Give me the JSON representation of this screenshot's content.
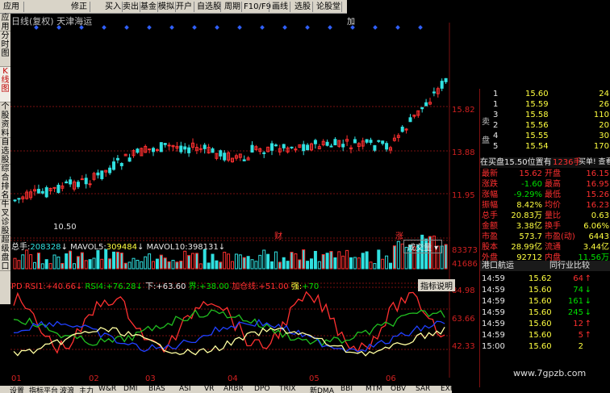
{
  "toolbar": {
    "items": [
      "应用",
      "修正",
      "买入",
      "卖出",
      "基金",
      "模拟",
      "开户",
      "自选股",
      "周期",
      "F10/F9",
      "画线",
      "选股",
      "论股堂"
    ],
    "right_label": "加"
  },
  "sidebar_tabs": [
    "应用",
    "分时图",
    "K线图",
    "个股资料",
    "自选股",
    "综合排名",
    "牛叉诊股",
    "超级盘口"
  ],
  "chart": {
    "title": "日线(复权)",
    "stock_name": "天津海运",
    "min_label": "10.50",
    "price_ticks": [
      "15.82",
      "13.88",
      "11.95"
    ],
    "vol_ticks": [
      "83373",
      "41686"
    ],
    "ind_ticks": [
      "84.98",
      "63.66",
      "42.33"
    ],
    "date_ticks": [
      "01",
      "02",
      "03",
      "04",
      "05",
      "06"
    ],
    "markers": [
      "财",
      "涨"
    ],
    "colors": {
      "up": "#ff3030",
      "down": "#30e0e0",
      "grid": "#7a1010"
    }
  },
  "volume_panel": {
    "label_total": "总手:",
    "total": "208328",
    "mavol5_label": "MAVOL5:",
    "mavol5": "309484",
    "mavol10_label": "MAVOL10:",
    "mavol10": "398131",
    "dropdown": "成交量"
  },
  "indicator_panel": {
    "parts": [
      "PD RSI1:",
      "+40.66",
      "RSI4:",
      "+76.28",
      "下:",
      "+63.60",
      "界:",
      "+38.00",
      "加仓线:",
      "+51.00",
      "强:",
      "+70"
    ],
    "help_button": "指标说明"
  },
  "order_book": {
    "sell_label": "卖",
    "buy_label": "盘",
    "sells": [
      [
        "1",
        "15.60",
        "24"
      ],
      [
        "1",
        "15.59",
        "26"
      ],
      [
        "3",
        "15.58",
        "110"
      ],
      [
        "2",
        "15.56",
        "20"
      ],
      [
        "4",
        "15.55",
        "30"
      ],
      [
        "5",
        "15.54",
        "170"
      ]
    ]
  },
  "status_line": {
    "text": "在买盘15.50位置有",
    "qty": "1236手",
    "link": "买单! 查看详细"
  },
  "stats": [
    [
      "最新",
      "15.62",
      "开盘",
      "16.15"
    ],
    [
      "涨跌",
      "-1.60",
      "最高",
      "16.95"
    ],
    [
      "涨幅",
      "-9.29%",
      "最低",
      "15.26"
    ],
    [
      "振幅",
      "8.42%",
      "均价",
      "16.23"
    ],
    [
      "总手",
      "20.83万",
      "量比",
      "0.63"
    ],
    [
      "金额",
      "3.38亿",
      "换手",
      "6.06%"
    ],
    [
      "市盈",
      "573.7",
      "市盈(动)",
      "6443"
    ],
    [
      "股本",
      "28.99亿",
      "流通",
      "3.44亿"
    ],
    [
      "外盘",
      "92712",
      "内盘",
      "11.56万"
    ]
  ],
  "trades_header": {
    "left": "港口航运",
    "right": "同行业比较"
  },
  "trades": [
    [
      "14:59",
      "15.62",
      "64",
      "up"
    ],
    [
      "14:59",
      "15.60",
      "74",
      "down"
    ],
    [
      "14:59",
      "15.60",
      "161",
      "down"
    ],
    [
      "14:59",
      "15.60",
      "245",
      "down"
    ],
    [
      "14:59",
      "15.60",
      "12",
      "up"
    ],
    [
      "14:59",
      "15.60",
      "5",
      "up"
    ],
    [
      "15:00",
      "15.60",
      "2",
      ""
    ]
  ],
  "bottom_tabs": [
    "设置",
    "指标平台",
    "波浪",
    "主力",
    "W&R",
    "DMI",
    "BIAS",
    "ASI",
    "VR",
    "ARBR",
    "DPO",
    "TRIX",
    "新DMA",
    "BBI",
    "MTM",
    "OBV",
    "SAR",
    "EXPMA",
    "CYS经验"
  ],
  "watermark": "www.7gpzb.com"
}
